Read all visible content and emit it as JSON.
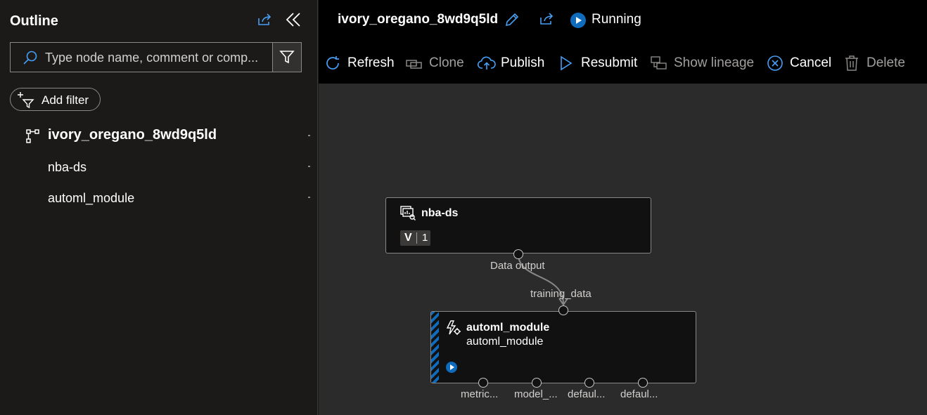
{
  "outline": {
    "title": "Outline",
    "search_placeholder": "Type node name, comment or comp...",
    "add_filter_label": "Add filter",
    "tree": [
      {
        "label": "ivory_oregano_8wd9q5ld",
        "icon": "pipeline-icon"
      },
      {
        "label": "nba-ds"
      },
      {
        "label": "automl_module"
      }
    ]
  },
  "header": {
    "run_title": "ivory_oregano_8wd9q5ld",
    "status": "Running"
  },
  "toolbar": [
    {
      "label": "Refresh",
      "icon": "refresh-icon",
      "enabled": true
    },
    {
      "label": "Clone",
      "icon": "clone-icon",
      "enabled": false
    },
    {
      "label": "Publish",
      "icon": "publish-icon",
      "enabled": true
    },
    {
      "label": "Resubmit",
      "icon": "resubmit-icon",
      "enabled": true
    },
    {
      "label": "Show lineage",
      "icon": "lineage-icon",
      "enabled": false
    },
    {
      "label": "Cancel",
      "icon": "cancel-icon",
      "enabled": true
    },
    {
      "label": "Delete",
      "icon": "delete-icon",
      "enabled": false
    }
  ],
  "graph": {
    "dataset_node": {
      "title": "nba-ds",
      "version_key": "V",
      "version_value": "1",
      "output_port_label": "Data output"
    },
    "module_node": {
      "title": "automl_module",
      "subtitle": "automl_module",
      "input_port_label": "training_data",
      "output_ports": [
        "metric...",
        "model_...",
        "defaul...",
        "defaul..."
      ]
    }
  },
  "colors": {
    "accent": "#0f6cbd",
    "icon_blue": "#479ef5",
    "canvas_bg": "#2b2b2b",
    "toolbar_bg": "#000000",
    "panel_bg": "#1b1a19"
  }
}
